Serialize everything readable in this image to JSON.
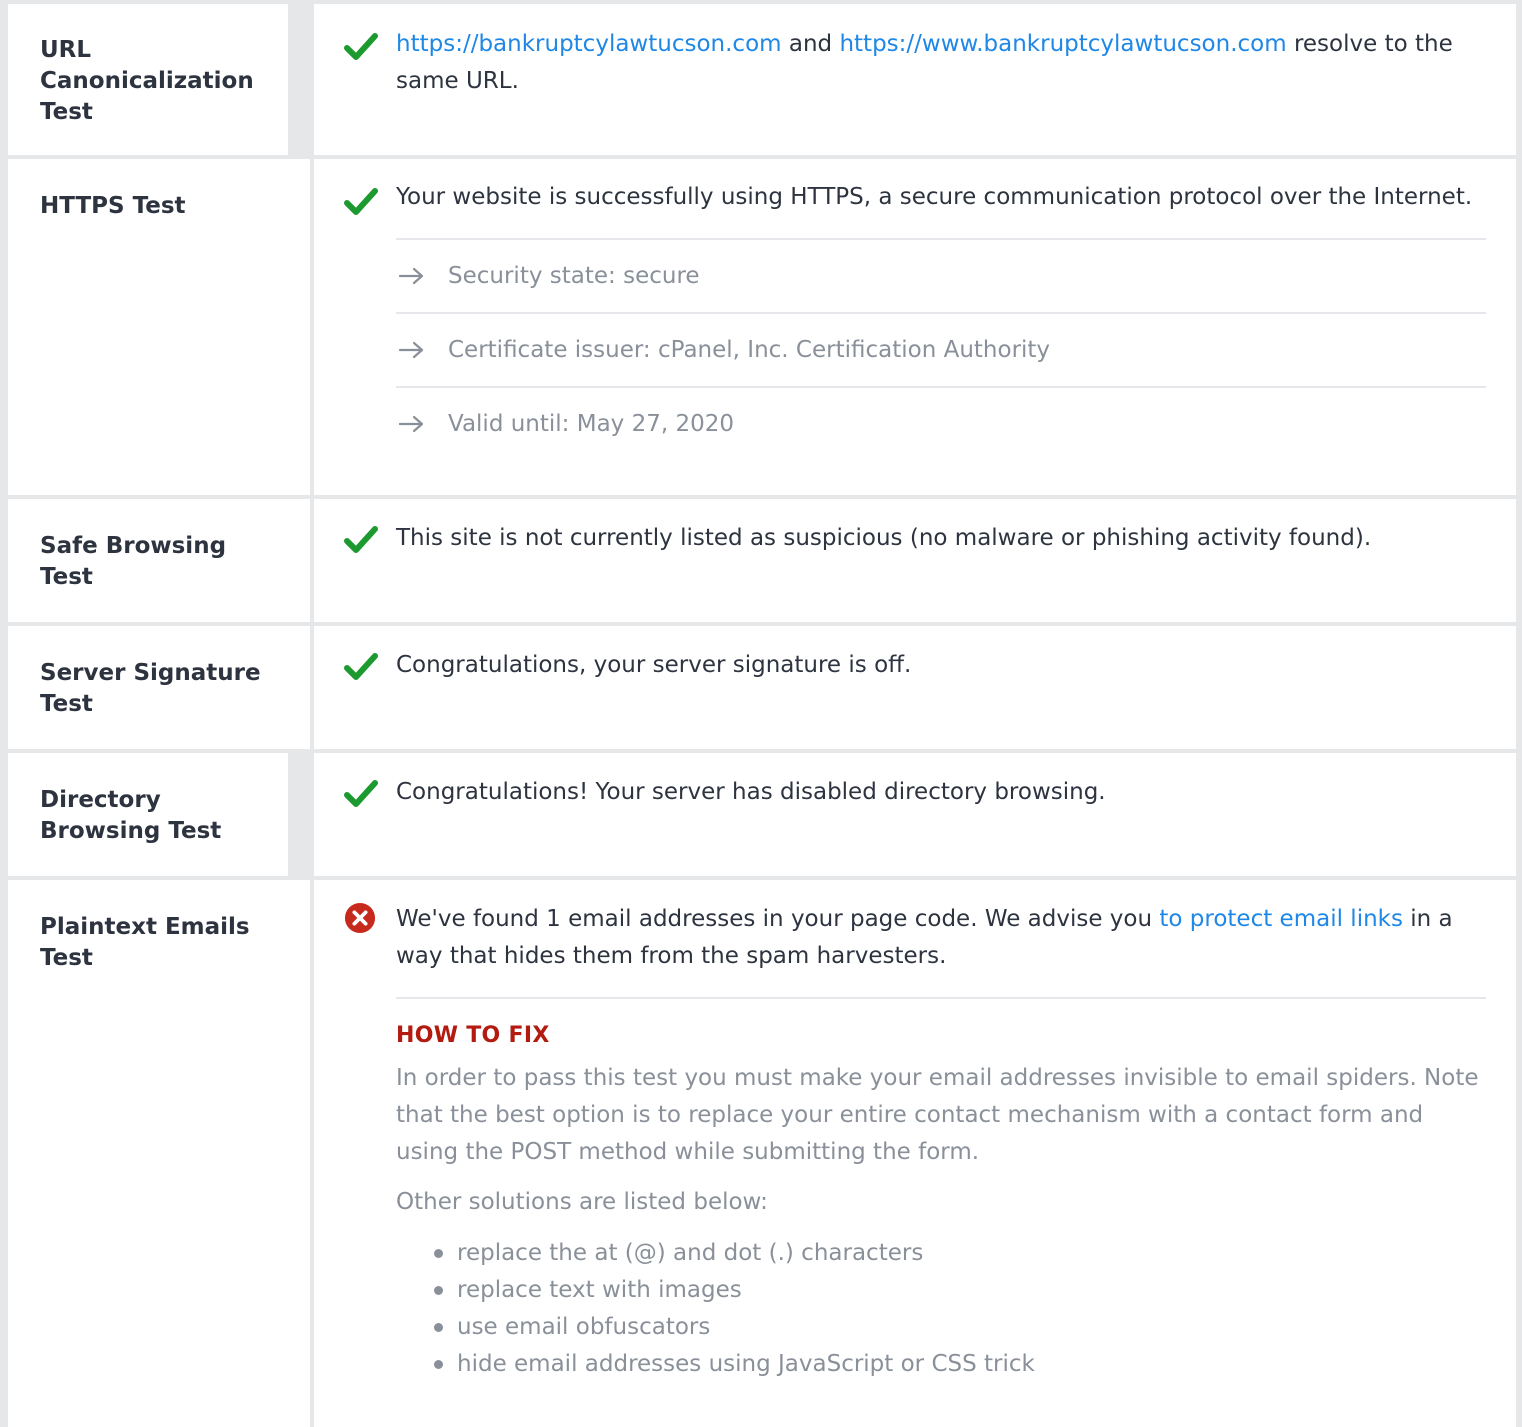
{
  "colors": {
    "pass": "#1d9a2f",
    "fail": "#c62a1c",
    "link": "#1f87e5",
    "fix_heading": "#b31b10"
  },
  "tests": [
    {
      "label": "URL Canonicalization Test",
      "status": "pass",
      "status_icon": "checkmark-icon",
      "link1": "https://bankruptcylawtucson.com",
      "conj": " and ",
      "link2": "https://www.bankruptcylawtucson.com",
      "tail": " resolve to the same URL."
    },
    {
      "label": "HTTPS Test",
      "status": "pass",
      "status_icon": "checkmark-icon",
      "text": "Your website is successfully using HTTPS, a secure communication protocol over the Internet.",
      "details": [
        "Security state: secure",
        "Certificate issuer: cPanel, Inc. Certification Authority",
        "Valid until: May 27, 2020"
      ]
    },
    {
      "label": "Safe Browsing Test",
      "status": "pass",
      "status_icon": "checkmark-icon",
      "text": "This site is not currently listed as suspicious (no malware or phishing activity found)."
    },
    {
      "label": "Server Signature Test",
      "status": "pass",
      "status_icon": "checkmark-icon",
      "text": "Congratulations, your server signature is off."
    },
    {
      "label": "Directory Browsing Test",
      "status": "pass",
      "status_icon": "checkmark-icon",
      "text": "Congratulations! Your server has disabled directory browsing."
    },
    {
      "label": "Plaintext Emails Test",
      "status": "fail",
      "status_icon": "error-x-icon",
      "text_before": "We've found 1 email addresses in your page code. We advise you ",
      "link": "to protect email links",
      "text_after": " in a way that hides them from the spam harvesters.",
      "fix_heading": "HOW TO FIX",
      "fix_text": "In order to pass this test you must make your email addresses invisible to email spiders. Note that the best option is to replace your entire contact mechanism with a contact form and using the POST method while submitting the form.",
      "fix_sub": "Other solutions are listed below:",
      "solutions": [
        "replace the at (@) and dot (.) characters",
        "replace text with images",
        "use email obfuscators",
        "hide email addresses using JavaScript or CSS trick"
      ]
    }
  ]
}
